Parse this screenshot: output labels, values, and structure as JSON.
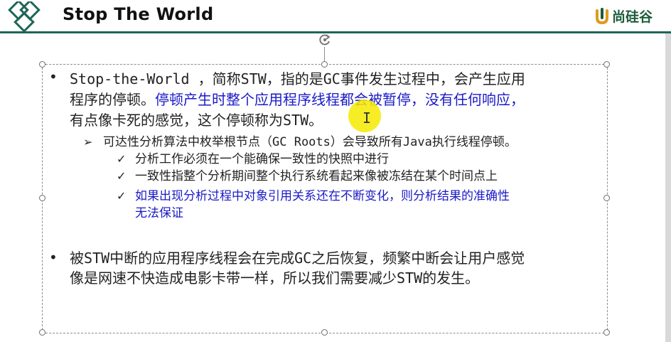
{
  "slide": {
    "title": "Stop The World",
    "brand": "尚硅谷"
  },
  "content": {
    "p1": {
      "l1a": "Stop-the-World ，",
      "l1b": "简称",
      "l1c": "STW",
      "l1d": "，指的是",
      "l1e": "GC",
      "l1f": "事件发生过程中，会产生应用",
      "l2a": "程序的停顿。",
      "l2b": "停顿产生时整个应用程序线程都会被暂停，没有任何响应，",
      "l3a": "有点像卡死的感觉，这个停顿称为",
      "l3b": "STW",
      "l3c": "。"
    },
    "sub1": {
      "a": "可达性分析算法中枚举根节点（",
      "b": "GC Roots",
      "c": "）会导致所有",
      "d": "Java",
      "e": "执行线程停顿。"
    },
    "checks": [
      "分析工作必须在一个能确保一致性的快照中进行",
      "一致性指整个分析期间整个执行系统看起来像被冻结在某个时间点上",
      "如果出现分析过程中对象引用关系还在不断变化，则分析结果的准确性",
      "无法保证"
    ],
    "p2": {
      "l1a": "被",
      "l1b": "STW",
      "l1c": "中断的应用程序线程会在完成",
      "l1d": "GC",
      "l1e": "之后恢复，频繁中断会让用户感觉",
      "l2a": "像是网速不快造成电影卡带一样，所以我们需要减少",
      "l2b": "STW",
      "l2c": "的发生。"
    }
  },
  "colors": {
    "header_rule": "#1f6657",
    "emphasis_text": "#1a1ac8",
    "cursor_highlight": "#f6ea00"
  },
  "icons": [
    "diamonds-logo-icon",
    "brand-logo-icon",
    "rotate-handle-icon",
    "bullet-dot-icon",
    "arrow-bullet-icon",
    "check-icon",
    "text-cursor-icon"
  ]
}
